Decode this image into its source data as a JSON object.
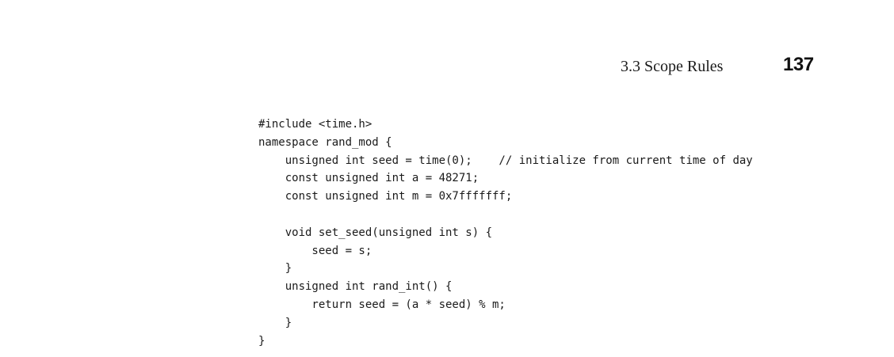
{
  "header": {
    "section_title": "3.3  Scope Rules",
    "page_number": "137"
  },
  "code": {
    "lines": [
      "#include <time.h>",
      "namespace rand_mod {",
      "    unsigned int seed = time(0);    // initialize from current time of day",
      "    const unsigned int a = 48271;",
      "    const unsigned int m = 0x7fffffff;",
      "",
      "    void set_seed(unsigned int s) {",
      "        seed = s;",
      "    }",
      "    unsigned int rand_int() {",
      "        return seed = (a * seed) % m;",
      "    }",
      "}"
    ]
  }
}
